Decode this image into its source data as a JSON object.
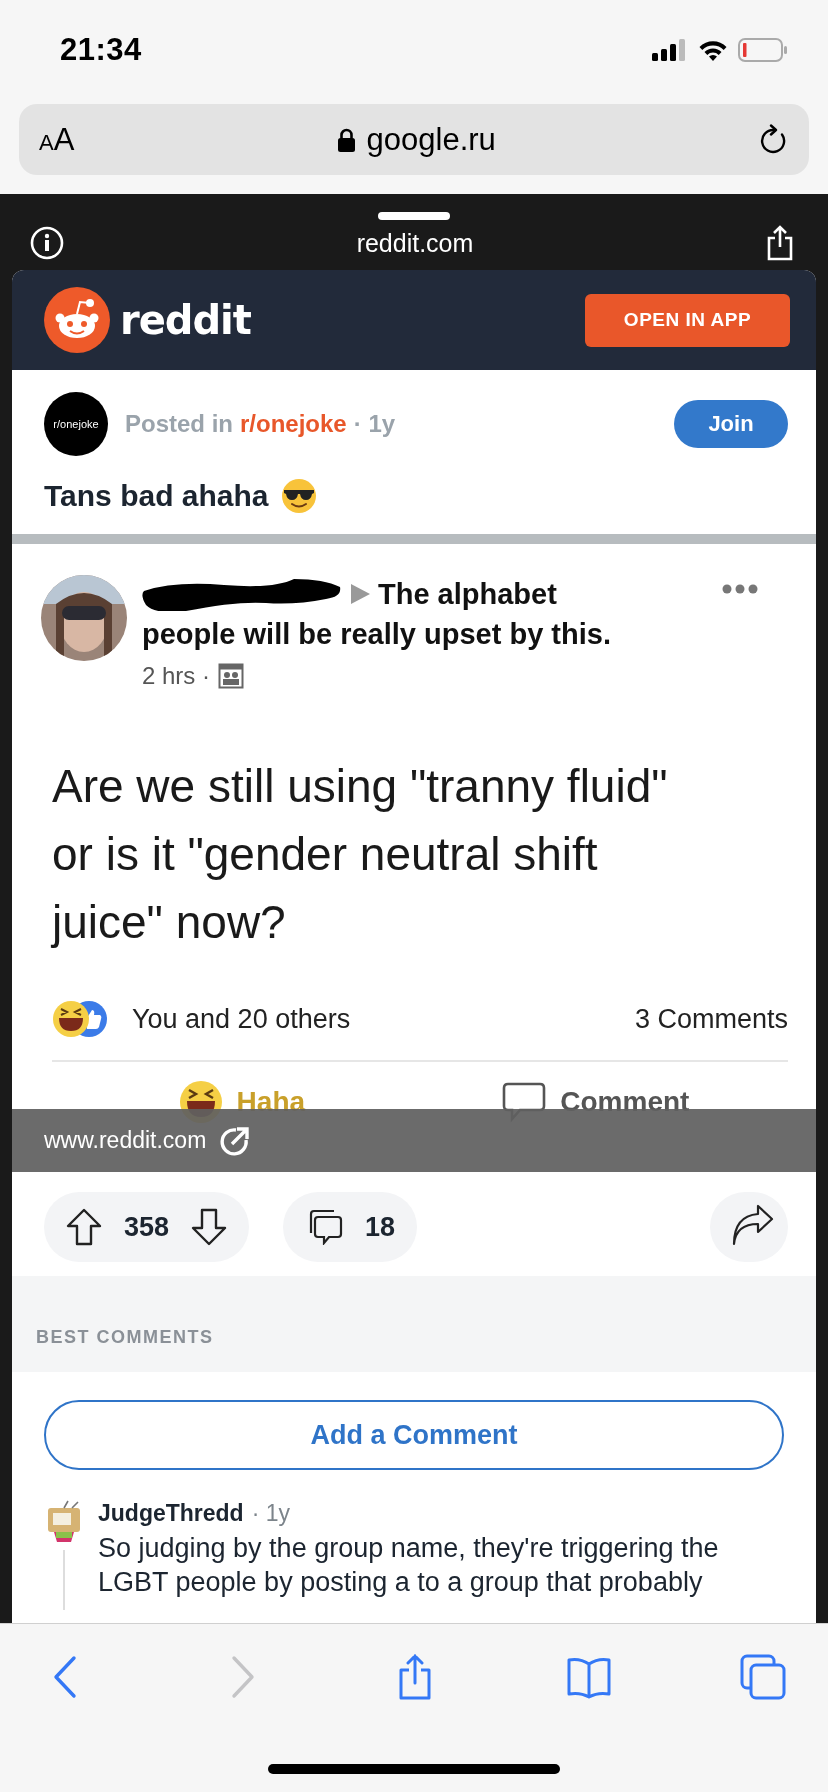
{
  "status_bar": {
    "time": "21:34"
  },
  "address_bar": {
    "text_size_button": "AA",
    "url": "google.ru"
  },
  "sheet": {
    "domain": "reddit.com"
  },
  "reddit_header": {
    "logo_text": "reddit",
    "open_button": "OPEN IN APP"
  },
  "post": {
    "subreddit_avatar": "r/onejoke",
    "posted_in": "Posted in",
    "subreddit": "r/onejoke",
    "age": "· 1y",
    "join_button": "Join",
    "title": "Tans bad ahaha"
  },
  "embedded_post": {
    "header_first_line": "The alphabet",
    "header_second_line": "people will be really upset by this.",
    "time": "2 hrs ·",
    "body": "Are we still using \"tranny fluid\" or is it \"gender neutral shift juice\" now?",
    "reactions": "You and 20 others",
    "comment_count": "3 Comments",
    "actions": [
      "Haha",
      "Comment"
    ]
  },
  "link_overlay": {
    "url": "www.reddit.com"
  },
  "post_actions": {
    "score": "358",
    "comments": "18"
  },
  "comments_section": {
    "heading": "BEST COMMENTS",
    "add_button": "Add a Comment",
    "comments": [
      {
        "author": "JudgeThredd",
        "age": "· 1y",
        "text": "So judging by the group name, they're triggering the LGBT people by posting a to a group that probably"
      }
    ]
  },
  "toolbar": [
    {
      "kind": "back",
      "disabled": false
    },
    {
      "kind": "forward",
      "disabled": true
    },
    {
      "kind": "share",
      "disabled": false
    },
    {
      "kind": "bookmarks",
      "disabled": false
    },
    {
      "kind": "tabs",
      "disabled": false
    }
  ]
}
